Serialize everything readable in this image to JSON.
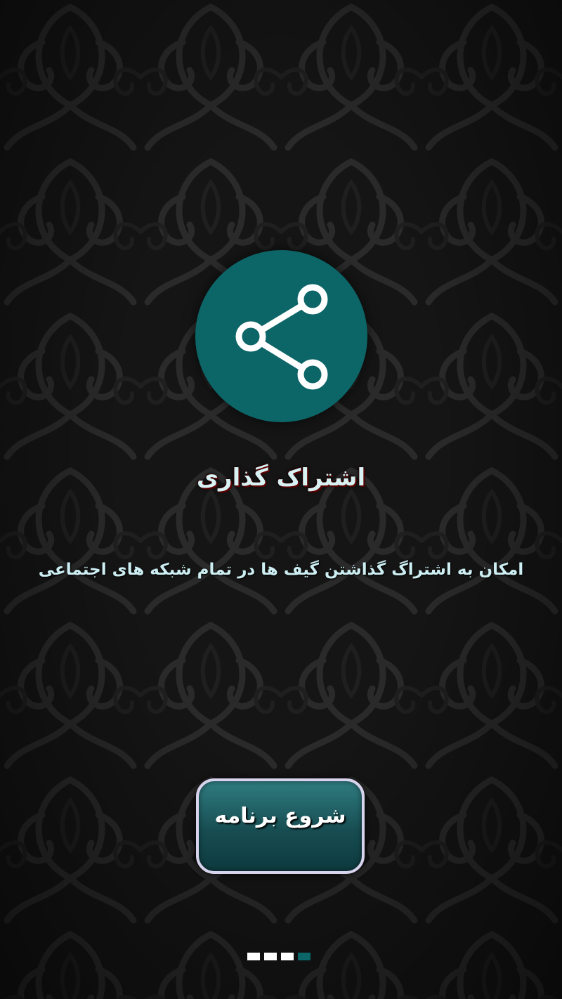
{
  "colors": {
    "background": "#141414",
    "accent": "#0c6567",
    "title_text": "#d8f2f4",
    "button_border": "#d9d4ee"
  },
  "hero": {
    "icon": "share-icon"
  },
  "title": "اشتراک گذاری",
  "subtitle": "امکان به اشتراگ گذاشتن گیف ها در تمام شبکه های اجتماعی",
  "start_button": {
    "label": "شروع برنامه"
  },
  "pager": {
    "total": 4,
    "active_index": 3
  }
}
